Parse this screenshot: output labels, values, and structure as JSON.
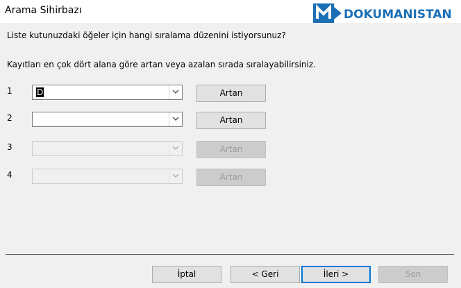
{
  "window": {
    "title": "Arama Sihirbazı"
  },
  "logo": {
    "text": "DOKUMANISTAN"
  },
  "prompt": "Liste kutunuzdaki öğeler için hangi sıralama düzenini istiyorsunuz?",
  "info": "Kayıtları en çok dört alana göre artan veya azalan sırada sıralayabilirsiniz.",
  "sort_rows": [
    {
      "num": "1",
      "value": "D",
      "order": "Artan"
    },
    {
      "num": "2",
      "value": "",
      "order": "Artan"
    },
    {
      "num": "3",
      "value": "",
      "order": "Artan"
    },
    {
      "num": "4",
      "value": "",
      "order": "Artan"
    }
  ],
  "buttons": {
    "cancel": "İptal",
    "back": "< Geri",
    "next": "İleri >",
    "finish": "Son"
  },
  "colors": {
    "accent": "#0078d7",
    "logo": "#1b6fb5"
  }
}
